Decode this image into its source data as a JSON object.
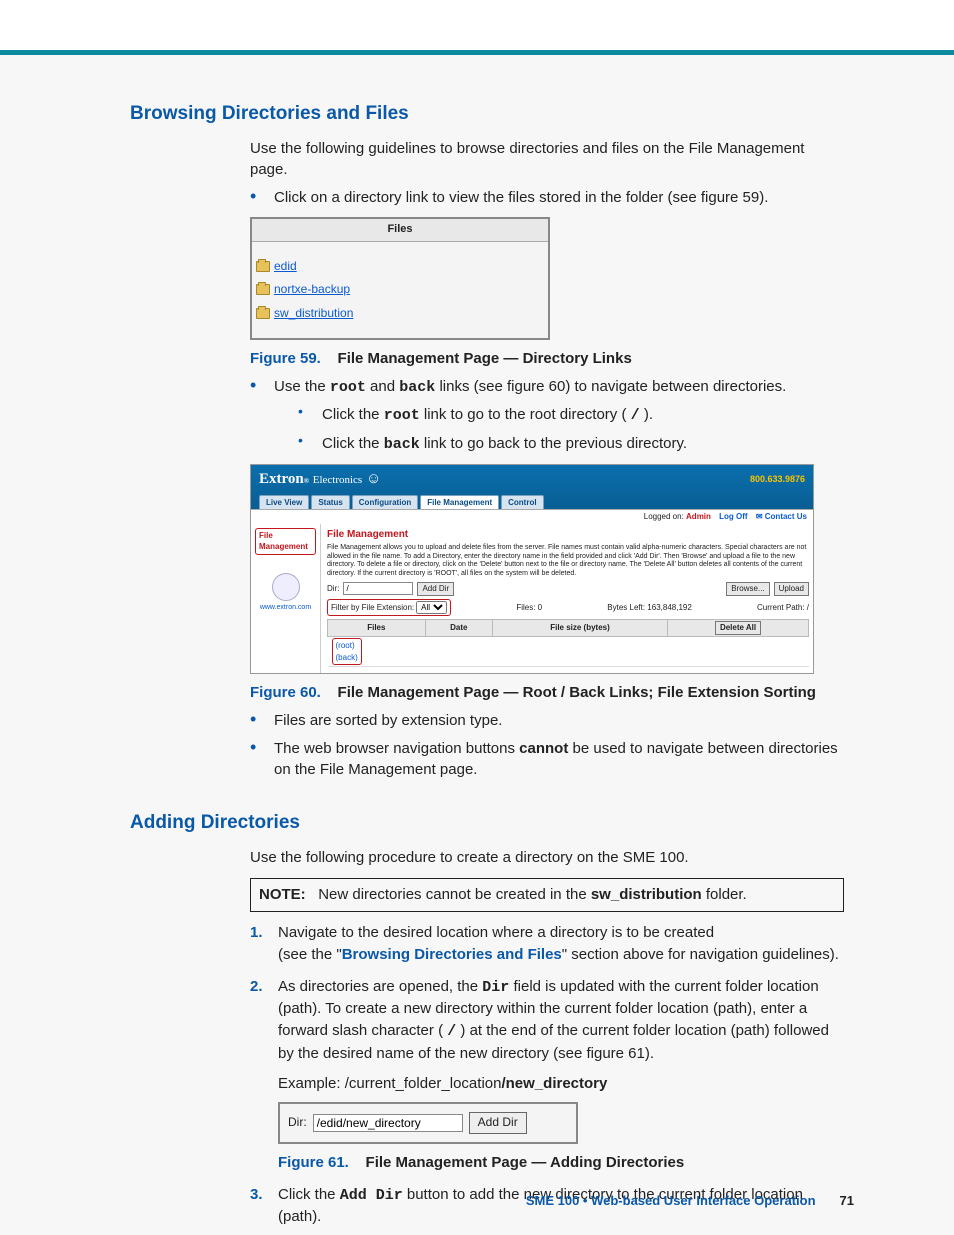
{
  "section1": {
    "title": "Browsing Directories and Files",
    "intro": "Use the following guidelines to browse directories and files on the File Management page.",
    "b1": "Click on a directory link to view the files stored in the folder (see figure 59).",
    "b2a": "Use the ",
    "b2b": " and ",
    "b2c": " links (see figure 60) to navigate between directories.",
    "root": "root",
    "back": "back",
    "c1a": "Click the ",
    "c1b": " link to go to the root directory ( ",
    "c1c": " ).",
    "slash": "/",
    "c2a": "Click the ",
    "c2b": " link to go back to the previous directory.",
    "b3": "Files are sorted by extension type.",
    "b4a": "The web browser navigation buttons ",
    "b4b": "cannot",
    "b4c": " be used to navigate between directories on the File Management page."
  },
  "fig59": {
    "caption_num": "Figure 59.",
    "caption_text": "File Management Page — Directory Links",
    "header": "Files",
    "links": [
      "edid",
      "nortxe-backup",
      "sw_distribution"
    ]
  },
  "fig60": {
    "caption_num": "Figure 60.",
    "caption_text": "File Management Page — Root / Back Links; File Extension Sorting",
    "brand": "Extron",
    "brand2": "Electronics",
    "phone": "800.633.9876",
    "tabs": [
      "Live View",
      "Status",
      "Configuration",
      "File Management",
      "Control"
    ],
    "logged": "Logged on:",
    "admin": "Admin",
    "logoff": "Log Off",
    "contact": "Contact Us",
    "side_label": "File Management",
    "side_url": "www.extron.com",
    "fm_title": "File Management",
    "fm_desc": "File Management allows you to upload and delete files from the server. File names must contain valid alpha-numeric characters. Special characters are not allowed in the file name. To add a Directory, enter the directory name in the field provided and click 'Add Dir'. Then 'Browse' and upload a file to the new directory. To delete a file or directory, click on the 'Delete' button next to the file or directory name. The 'Delete All' button deletes all contents of the current directory. If the current directory is 'ROOT', all files on the system will be deleted.",
    "dir_label": "Dir:",
    "dir_value": "/",
    "add_dir": "Add Dir",
    "browse": "Browse...",
    "upload": "Upload",
    "filter_label": "Filter by File Extension:",
    "filter_value": "All",
    "files_count": "Files: 0",
    "bytes_left": "Bytes Left: 163,848,192",
    "current_path": "Current Path: /",
    "th_files": "Files",
    "th_date": "Date",
    "th_size": "File size (bytes)",
    "delete_all": "Delete All",
    "root_link": "(root)",
    "back_link": "(back)"
  },
  "section2": {
    "title": "Adding Directories",
    "intro": "Use the following procedure to create a directory on the SME 100.",
    "note_label": "NOTE:",
    "note_a": "New directories cannot be created in the ",
    "note_b": "sw_distribution",
    "note_c": " folder.",
    "s1a": "Navigate to the desired location where a directory is to be created",
    "s1b": "(see the \"",
    "s1c": "Browsing Directories and Files",
    "s1d": "\" section above for navigation guidelines).",
    "s2a": "As directories are opened, the ",
    "s2b": "Dir",
    "s2c": " field is updated with the current folder location (path). To create a new directory within the current folder location (path), enter a forward slash character ( ",
    "s2d": "/",
    "s2e": " ) at the end of the current folder location (path) followed by the desired name of the new directory (see figure 61).",
    "example_a": "Example: /current_folder_location",
    "example_b": "/new_directory",
    "s3a": "Click the ",
    "s3b": "Add Dir",
    "s3c": " button to add the new directory to the current folder location (path)."
  },
  "fig61": {
    "caption_num": "Figure 61.",
    "caption_text": "File Management Page — Adding Directories",
    "dir_label": "Dir:",
    "dir_value": "/edid/new_directory",
    "add_dir": "Add Dir"
  },
  "footer": {
    "text": "SME 100 • Web-based User Interface Operation",
    "page": "71"
  }
}
